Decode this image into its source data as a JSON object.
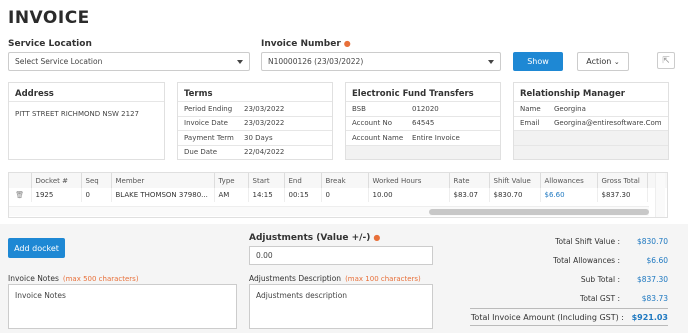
{
  "page_title": "INVOICE",
  "service_location": {
    "label": "Service Location",
    "value": "Select Service Location"
  },
  "invoice_number": {
    "label": "Invoice Number",
    "value": "N10000126 (23/03/2022)"
  },
  "buttons": {
    "show": "Show",
    "action": "Action",
    "add_docket": "Add docket"
  },
  "address": {
    "title": "Address",
    "value": "PITT STREET RICHMOND NSW 2127"
  },
  "terms": {
    "title": "Terms",
    "rows": [
      {
        "k": "Period Ending",
        "v": "23/03/2022"
      },
      {
        "k": "Invoice Date",
        "v": "23/03/2022"
      },
      {
        "k": "Payment Term",
        "v": "30 Days"
      },
      {
        "k": "Due Date",
        "v": "22/04/2022"
      }
    ]
  },
  "eft": {
    "title": "Electronic Fund Transfers",
    "rows": [
      {
        "k": "BSB",
        "v": "012020"
      },
      {
        "k": "Account No",
        "v": "64545"
      },
      {
        "k": "Account Name",
        "v": "Entire Invoice"
      }
    ]
  },
  "manager": {
    "title": "Relationship Manager",
    "rows": [
      {
        "k": "Name",
        "v": "Georgina"
      },
      {
        "k": "Email",
        "v": "Georgina@entiresoftware.Com"
      }
    ]
  },
  "table": {
    "columns": [
      "Docket #",
      "Seq",
      "Member",
      "Type",
      "Start",
      "End",
      "Break",
      "Worked Hours",
      "Rate",
      "Shift Value",
      "Allowances",
      "Gross Total"
    ],
    "rows": [
      [
        "1925",
        "0",
        "BLAKE THOMSON 37980...",
        "AM",
        "14:15",
        "00:15",
        "0",
        "10.00",
        "$83.07",
        "$830.70",
        "$6.60",
        "$837.30"
      ]
    ]
  },
  "adjustments": {
    "label": "Adjustments (Value +/-)",
    "value": "0.00"
  },
  "invoice_notes": {
    "label": "Invoice Notes",
    "hint": "(max 500 characters)",
    "placeholder": "Invoice Notes"
  },
  "adjustments_desc": {
    "label": "Adjustments Description",
    "hint": "(max 100 characters)",
    "placeholder": "Adjustments description"
  },
  "totals": {
    "shift": {
      "label": "Total Shift Value :",
      "value": "$830.70"
    },
    "allowances": {
      "label": "Total Allowances :",
      "value": "$6.60"
    },
    "subtotal": {
      "label": "Sub Total :",
      "value": "$837.30"
    },
    "gst": {
      "label": "Total GST :",
      "value": "$83.73"
    },
    "invoice": {
      "label": "Total Invoice Amount (Including GST) :",
      "value": "$921.03"
    }
  },
  "colors": {
    "accent": "#1e88d4",
    "required": "#e8703a",
    "link": "#1e78c0"
  },
  "icons": {
    "delete": "trash-icon",
    "expand": "expand-icon"
  }
}
